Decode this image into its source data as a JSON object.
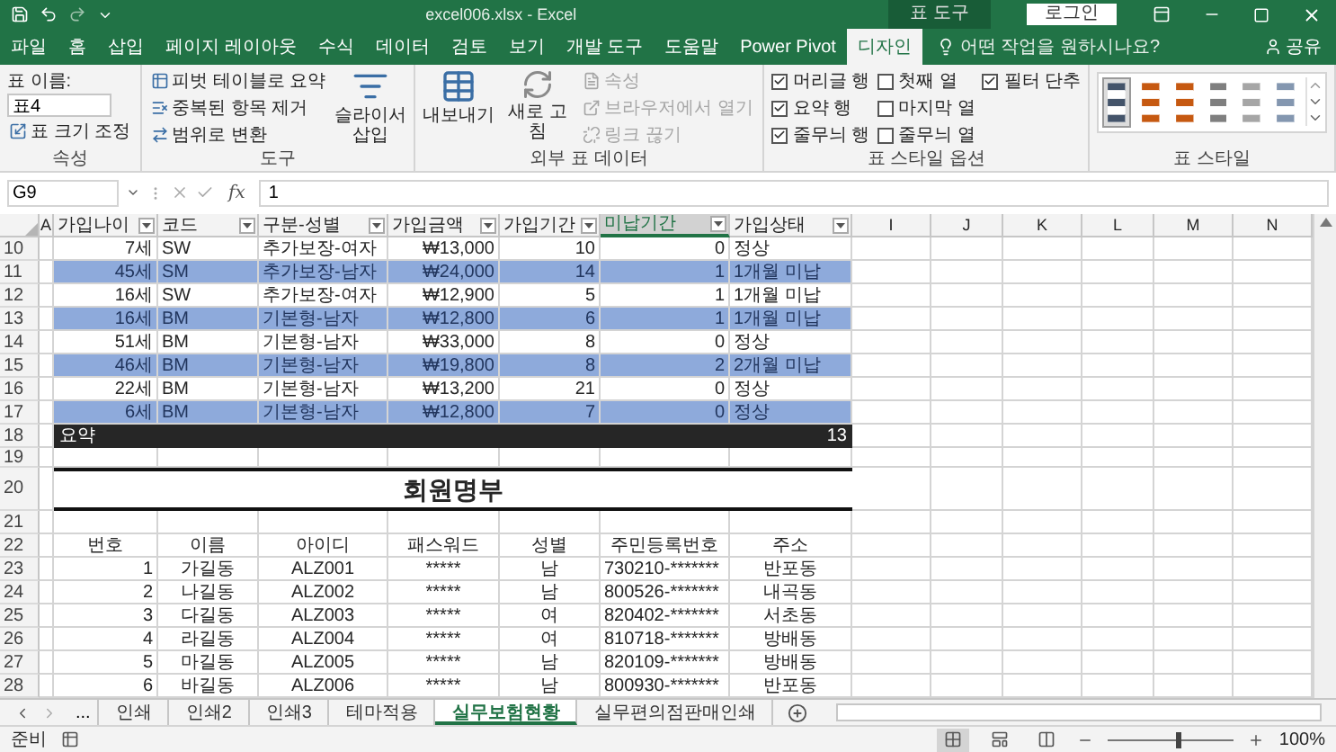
{
  "window": {
    "title": "excel006.xlsx - Excel",
    "context_label": "표 도구",
    "login_button": "로그인"
  },
  "menu_tabs": [
    {
      "label": "파일",
      "selected": false
    },
    {
      "label": "홈",
      "selected": false
    },
    {
      "label": "삽입",
      "selected": false
    },
    {
      "label": "페이지 레이아웃",
      "selected": false
    },
    {
      "label": "수식",
      "selected": false
    },
    {
      "label": "데이터",
      "selected": false
    },
    {
      "label": "검토",
      "selected": false
    },
    {
      "label": "보기",
      "selected": false
    },
    {
      "label": "개발 도구",
      "selected": false
    },
    {
      "label": "도움말",
      "selected": false
    },
    {
      "label": "Power Pivot",
      "selected": false
    },
    {
      "label": "디자인",
      "selected": true
    }
  ],
  "tell_me": {
    "placeholder": "어떤 작업을 원하시나요?"
  },
  "share_button": "공유",
  "ribbon": {
    "properties": {
      "name_label": "표 이름:",
      "name_value": "표4",
      "resize_button": "표 크기 조정",
      "group_label": "속성"
    },
    "tools": {
      "items": [
        "피벗 테이블로 요약",
        "중복된 항목 제거",
        "범위로 변환"
      ],
      "slicer_button": "슬라이서 삽입",
      "group_label": "도구"
    },
    "external": {
      "export_button": "내보내기",
      "refresh_button": "새로 고침",
      "items": [
        {
          "label": "속성",
          "disabled": true
        },
        {
          "label": "브라우저에서 열기",
          "disabled": true
        },
        {
          "label": "링크 끊기",
          "disabled": true
        }
      ],
      "group_label": "외부 표 데이터"
    },
    "style_options": {
      "options": [
        {
          "label": "머리글 행",
          "checked": true
        },
        {
          "label": "요약 행",
          "checked": true
        },
        {
          "label": "줄무늬 행",
          "checked": true
        },
        {
          "label": "첫째 열",
          "checked": false
        },
        {
          "label": "마지막 열",
          "checked": false
        },
        {
          "label": "줄무늬 열",
          "checked": false
        },
        {
          "label": "필터 단추",
          "checked": true
        }
      ],
      "group_label": "표 스타일 옵션"
    },
    "styles": {
      "swatches": [
        {
          "color": "#44546a",
          "selected": true
        },
        {
          "color": "#c65911",
          "selected": false
        },
        {
          "color": "#c65911",
          "selected": false
        },
        {
          "color": "#7f7f7f",
          "selected": false
        },
        {
          "color": "#a6a6a6",
          "selected": false
        },
        {
          "color": "#8497b0",
          "selected": false
        }
      ],
      "group_label": "표 스타일"
    }
  },
  "formula_bar": {
    "name_box": "G9",
    "function_label": "fx",
    "value": "1"
  },
  "sheet": {
    "columns": [
      {
        "label": "A",
        "filter": false,
        "selected": false
      },
      {
        "label": "가입나이",
        "filter": true,
        "selected": false
      },
      {
        "label": "코드",
        "filter": true,
        "selected": false
      },
      {
        "label": "구분-성별",
        "filter": true,
        "selected": false
      },
      {
        "label": "가입금액",
        "filter": true,
        "selected": false
      },
      {
        "label": "가입기간",
        "filter": true,
        "selected": false
      },
      {
        "label": "미납기간",
        "filter": true,
        "selected": true
      },
      {
        "label": "가입상태",
        "filter": true,
        "selected": false
      },
      {
        "label": "I",
        "filter": false,
        "selected": false
      },
      {
        "label": "J",
        "filter": false,
        "selected": false
      },
      {
        "label": "K",
        "filter": false,
        "selected": false
      },
      {
        "label": "L",
        "filter": false,
        "selected": false
      },
      {
        "label": "M",
        "filter": false,
        "selected": false
      },
      {
        "label": "N",
        "filter": false,
        "selected": false
      }
    ],
    "rows": [
      {
        "number": "10",
        "kind": "data",
        "banded": false,
        "cells": [
          "7세",
          "SW",
          "추가보장-여자",
          "₩13,000",
          "10",
          "0",
          "정상"
        ]
      },
      {
        "number": "11",
        "kind": "data",
        "banded": true,
        "cells": [
          "45세",
          "SM",
          "추가보장-남자",
          "₩24,000",
          "14",
          "1",
          "1개월 미납"
        ]
      },
      {
        "number": "12",
        "kind": "data",
        "banded": false,
        "cells": [
          "16세",
          "SW",
          "추가보장-여자",
          "₩12,900",
          "5",
          "1",
          "1개월 미납"
        ]
      },
      {
        "number": "13",
        "kind": "data",
        "banded": true,
        "cells": [
          "16세",
          "BM",
          "기본형-남자",
          "₩12,800",
          "6",
          "1",
          "1개월 미납"
        ]
      },
      {
        "number": "14",
        "kind": "data",
        "banded": false,
        "cells": [
          "51세",
          "BM",
          "기본형-남자",
          "₩33,000",
          "8",
          "0",
          "정상"
        ]
      },
      {
        "number": "15",
        "kind": "data",
        "banded": true,
        "cells": [
          "46세",
          "BM",
          "기본형-남자",
          "₩19,800",
          "8",
          "2",
          "2개월 미납"
        ]
      },
      {
        "number": "16",
        "kind": "data",
        "banded": false,
        "cells": [
          "22세",
          "BM",
          "기본형-남자",
          "₩13,200",
          "21",
          "0",
          "정상"
        ]
      },
      {
        "number": "17",
        "kind": "data",
        "banded": true,
        "cells": [
          "6세",
          "BM",
          "기본형-남자",
          "₩12,800",
          "7",
          "0",
          "정상"
        ]
      },
      {
        "number": "18",
        "kind": "summary",
        "label": "요약",
        "total": "13"
      },
      {
        "number": "19",
        "kind": "blank"
      },
      {
        "number": "20",
        "kind": "title",
        "text": "회원명부"
      },
      {
        "number": "21",
        "kind": "blank"
      },
      {
        "number": "22",
        "kind": "list_header",
        "cells": [
          "번호",
          "이름",
          "아이디",
          "패스워드",
          "성별",
          "주민등록번호",
          "주소"
        ]
      },
      {
        "number": "23",
        "kind": "list",
        "cells": [
          "1",
          "가길동",
          "ALZ001",
          "*****",
          "남",
          "730210-*******",
          "반포동"
        ]
      },
      {
        "number": "24",
        "kind": "list",
        "cells": [
          "2",
          "나길동",
          "ALZ002",
          "*****",
          "남",
          "800526-*******",
          "내곡동"
        ]
      },
      {
        "number": "25",
        "kind": "list",
        "cells": [
          "3",
          "다길동",
          "ALZ003",
          "*****",
          "여",
          "820402-*******",
          "서초동"
        ]
      },
      {
        "number": "26",
        "kind": "list",
        "cells": [
          "4",
          "라길동",
          "ALZ004",
          "*****",
          "여",
          "810718-*******",
          "방배동"
        ]
      },
      {
        "number": "27",
        "kind": "list",
        "cells": [
          "5",
          "마길동",
          "ALZ005",
          "*****",
          "남",
          "820109-*******",
          "방배동"
        ]
      },
      {
        "number": "28",
        "kind": "list",
        "cells": [
          "6",
          "바길동",
          "ALZ006",
          "*****",
          "남",
          "800930-*******",
          "반포동"
        ]
      }
    ]
  },
  "sheet_tabs": {
    "overflow": "...",
    "tabs": [
      {
        "label": "인쇄",
        "selected": false
      },
      {
        "label": "인쇄2",
        "selected": false
      },
      {
        "label": "인쇄3",
        "selected": false
      },
      {
        "label": "테마적용",
        "selected": false
      },
      {
        "label": "실무보험현황",
        "selected": true
      },
      {
        "label": "실무편의점판매인쇄",
        "selected": false
      }
    ]
  },
  "status_bar": {
    "status": "준비",
    "views": [
      {
        "kind": "normal",
        "selected": true
      },
      {
        "kind": "page_layout",
        "selected": false
      },
      {
        "kind": "page_break",
        "selected": false
      }
    ],
    "zoom": {
      "level": 0.55,
      "reading": "100%"
    }
  }
}
